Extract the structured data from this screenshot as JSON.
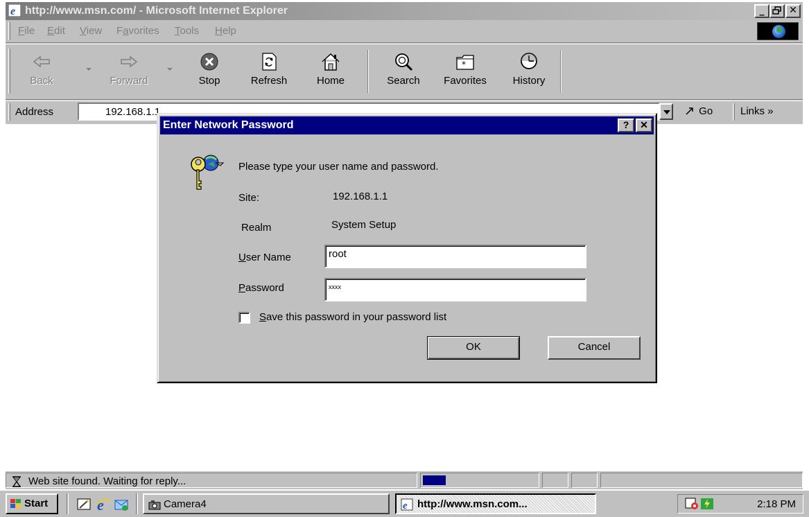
{
  "window": {
    "title": "http://www.msn.com/ - Microsoft Internet Explorer",
    "minimize_glyph": "_",
    "maximize_glyph": " ",
    "close_glyph": "✕"
  },
  "menu": {
    "items": [
      {
        "label": "File",
        "accel": "F"
      },
      {
        "label": "Edit",
        "accel": "E"
      },
      {
        "label": "View",
        "accel": "V"
      },
      {
        "label": "Favorites",
        "accel": "a"
      },
      {
        "label": "Tools",
        "accel": "T"
      },
      {
        "label": "Help",
        "accel": "H"
      }
    ]
  },
  "toolbar": {
    "buttons": [
      {
        "label": "Back",
        "icon": "back-arrow-icon",
        "enabled": false
      },
      {
        "label": "Forward",
        "icon": "forward-arrow-icon",
        "enabled": false
      },
      {
        "label": "Stop",
        "icon": "stop-icon",
        "enabled": true
      },
      {
        "label": "Refresh",
        "icon": "refresh-icon",
        "enabled": true
      },
      {
        "label": "Home",
        "icon": "home-icon",
        "enabled": true
      },
      {
        "label": "Search",
        "icon": "search-icon",
        "enabled": true
      },
      {
        "label": "Favorites",
        "icon": "favorites-icon",
        "enabled": true
      },
      {
        "label": "History",
        "icon": "history-icon",
        "enabled": true
      }
    ]
  },
  "address": {
    "label": "Address",
    "value": "192.168.1.1",
    "go_label": "Go",
    "links_label": "Links »"
  },
  "dialog": {
    "title": "Enter Network Password",
    "help_glyph": "?",
    "close_glyph": "✕",
    "prompt": "Please type your user name and password.",
    "site_label": "Site:",
    "site_value": "192.168.1.1",
    "realm_label": "Realm",
    "realm_value": "System Setup",
    "username_label": "User Name",
    "username_accel": "U",
    "username_value": "root",
    "password_label": "Password",
    "password_accel": "P",
    "password_value": "xxxx",
    "save_label": "Save this password in your password list",
    "save_accel": "S",
    "save_checked": false,
    "ok_label": "OK",
    "cancel_label": "Cancel"
  },
  "status": {
    "text": "Web site found. Waiting for reply...",
    "progress_percent": 20
  },
  "taskbar": {
    "start_label": "Start",
    "tasks": [
      {
        "label": "Camera4",
        "active": false
      },
      {
        "label": "http://www.msn.com...",
        "active": true
      }
    ],
    "clock": "2:18 PM"
  }
}
